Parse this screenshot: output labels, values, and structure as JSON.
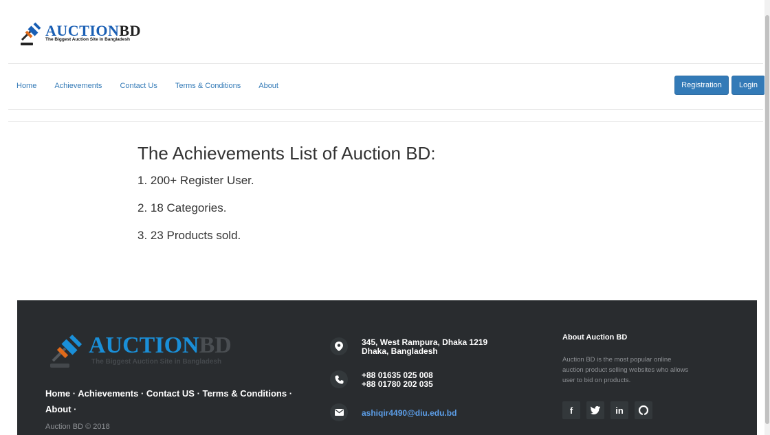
{
  "header": {
    "logo_main_a": "AUCTION",
    "logo_main_b": "BD",
    "logo_tagline": "The Biggest Auction Site in Bangladesh"
  },
  "nav": {
    "items": [
      "Home",
      "Achievements",
      "Contact Us",
      "Terms & Conditions",
      "About"
    ],
    "registration_label": "Registration",
    "login_label": "Login"
  },
  "main": {
    "title": "The Achievements List of Auction BD:",
    "items": [
      "1. 200+ Register User.",
      "2. 18 Categories.",
      "3. 23 Products sold."
    ]
  },
  "footer": {
    "logo_main_a": "AUCTION",
    "logo_main_b": "BD",
    "logo_tagline": "The Biggest Auction Site in Bangladesh",
    "links": [
      "Home",
      "Achievements",
      "Contact US",
      "Terms & Conditions",
      "About"
    ],
    "copyright": "Auction BD © 2018",
    "address_line1": "345, West Rampura, Dhaka 1219",
    "address_line2": "Dhaka, Bangladesh",
    "phone1": "+88 01635 025 008",
    "phone2": "+88 01780 202 035",
    "email": "ashiqir4490@diu.edu.bd",
    "about_heading": "About Auction BD",
    "about_text": "Auction BD is the most popular online auction product selling websites who allows user to bid on products.",
    "social_icons": [
      "facebook-icon",
      "twitter-icon",
      "linkedin-icon",
      "github-icon"
    ]
  },
  "colors": {
    "brand_blue": "#337ab7",
    "footer_bg": "#292c2f",
    "footer_email": "#5c9ee8"
  }
}
